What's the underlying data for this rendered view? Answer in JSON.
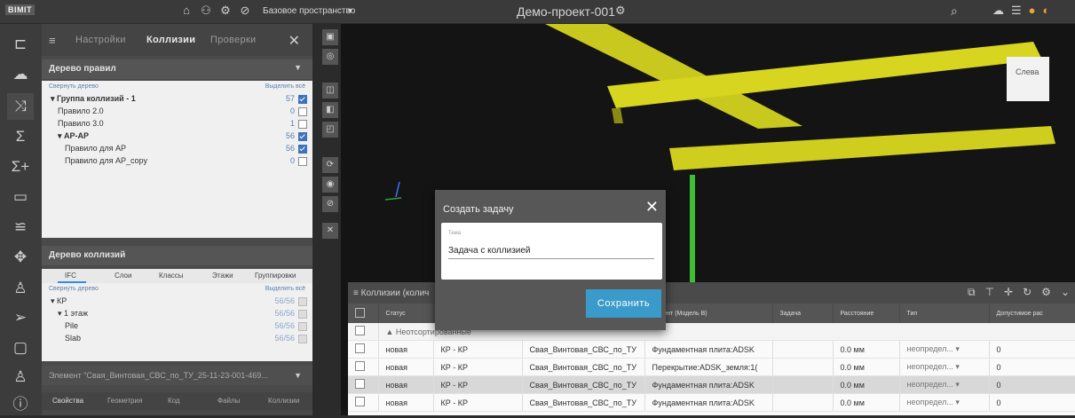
{
  "app": {
    "logo": "BIMIT",
    "space": "Базовое пространство",
    "project": "Демо-проект-001"
  },
  "panel": {
    "tabs": [
      "Настройки",
      "Коллизии",
      "Проверки"
    ],
    "rules_tree": {
      "title": "Дерево правил",
      "collapse_label": "Свернуть дерево",
      "select_all_label": "Выделить всё",
      "rows": [
        {
          "label": "Группа коллизий - 1",
          "count": "57",
          "checked": true,
          "level": 0,
          "bold": true
        },
        {
          "label": "Правило 2.0",
          "count": "0",
          "checked": false,
          "level": 1
        },
        {
          "label": "Правило 3.0",
          "count": "1",
          "checked": false,
          "level": 1
        },
        {
          "label": "АР-АР",
          "count": "56",
          "checked": true,
          "level": 1,
          "bold": true
        },
        {
          "label": "Правило для АР",
          "count": "56",
          "checked": true,
          "level": 2
        },
        {
          "label": "Правило для АР_copy",
          "count": "0",
          "checked": false,
          "level": 2
        }
      ]
    },
    "collisions_tree": {
      "title": "Дерево коллизий",
      "subtabs": [
        "IFC",
        "Слои",
        "Классы",
        "Этажи",
        "Группировки"
      ],
      "collapse_label": "Свернуть дерево",
      "select_all_label": "Выделить всё",
      "rows": [
        {
          "label": "КР",
          "count": "56/56"
        },
        {
          "label": "1 этаж",
          "count": "56/56"
        },
        {
          "label": "Pile",
          "count": "56/56"
        },
        {
          "label": "Slab",
          "count": "56/56"
        }
      ]
    },
    "element_title": "Элемент \"Свая_Винтовая_СВС_по_ТУ_25-11-23-001-469...",
    "element_tabs": [
      "Свойства",
      "Геометрия",
      "Код",
      "Файлы",
      "Коллизии"
    ]
  },
  "viewport": {
    "viewcube_label": "Слева"
  },
  "modal": {
    "title": "Создать задачу",
    "field_label": "Тема",
    "field_value": "Задача с коллизией",
    "save_label": "Сохранить"
  },
  "collisions": {
    "title": "Коллизии (колич",
    "columns": [
      "Статус",
      "",
      "",
      "лемент (Модель B)",
      "Задача",
      "Расстояние",
      "Тип",
      "Допустимое рас"
    ],
    "group_label": "Неотсортированные",
    "rows": [
      {
        "status": "новая",
        "pair": "КР - КР",
        "elem_a": "Свая_Винтовая_СВС_по_ТУ",
        "elem_b": "Фундаментная плита:ADSK",
        "task": "",
        "distance": "0.0 мм",
        "type": "неопредел...",
        "allowed": "0"
      },
      {
        "status": "новая",
        "pair": "КР - КР",
        "elem_a": "Свая_Винтовая_СВС_по_ТУ",
        "elem_b": "Перекрытие:ADSK_земля:1(",
        "task": "",
        "distance": "0.0 мм",
        "type": "неопредел...",
        "allowed": "0"
      },
      {
        "status": "новая",
        "pair": "КР - КР",
        "elem_a": "Свая_Винтовая_СВС_по_ТУ",
        "elem_b": "Фундаментная плита:ADSK",
        "task": "",
        "distance": "0.0 мм",
        "type": "неопредел...",
        "allowed": "0"
      },
      {
        "status": "новая",
        "pair": "КР - КР",
        "elem_a": "Свая_Винтовая_СВС_по_ТУ",
        "elem_b": "Фундаментная плита:ADSK",
        "task": "",
        "distance": "0.0 мм",
        "type": "неопредел...",
        "allowed": "0"
      }
    ]
  }
}
